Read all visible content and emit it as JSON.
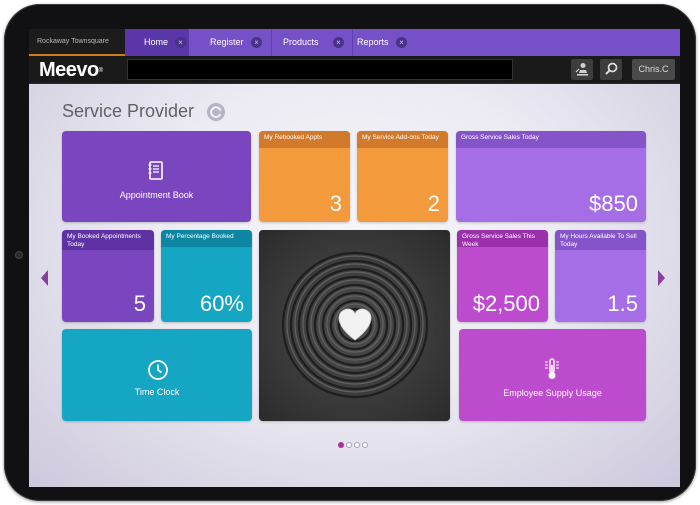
{
  "tabs": {
    "location": "Rockaway Townsquare",
    "items": [
      {
        "label": "Home"
      },
      {
        "label": "Register"
      },
      {
        "label": "Products"
      },
      {
        "label": "Reports"
      }
    ],
    "close_glyph": "×"
  },
  "header": {
    "logo": "Meevo",
    "logo_mark": "®",
    "user": "Chris.C",
    "icons": [
      "user-stamp-icon",
      "search-icon"
    ]
  },
  "page": {
    "title": "Service Provider",
    "refresh_icon": "refresh-icon"
  },
  "tiles": {
    "appointment_book": {
      "label": "Appointment Book",
      "color": "#7a46c0",
      "icon": "book-icon"
    },
    "rebooked_appts": {
      "label": "My Rebooked Appts",
      "value": "3",
      "color": "#f39a3c"
    },
    "service_addons": {
      "label": "My Service Add-ons Today",
      "value": "2",
      "color": "#f39a3c"
    },
    "gross_service_sales_today": {
      "label": "Gross Service Sales Today",
      "value": "$850",
      "color": "#a66ee6"
    },
    "booked_appts": {
      "label": "My Booked Appointments Today",
      "value": "5",
      "color": "#7a46c0"
    },
    "percentage_booked": {
      "label": "My Percentage Booked",
      "value": "60%",
      "color": "#15a6c4"
    },
    "zen_image": {
      "icon": "heart-stone-icon"
    },
    "gross_service_sales_week": {
      "label": "Gross Service Sales This Week",
      "value": "$2,500",
      "color": "#bc4bcd"
    },
    "hours_available": {
      "label": "My Hours Available To Sell Today",
      "value": "1.5",
      "color": "#a66ee6"
    },
    "time_clock": {
      "label": "Time Clock",
      "color": "#15a6c4",
      "icon": "clock-icon"
    },
    "supply_usage": {
      "label": "Employee Supply Usage",
      "color": "#bc4bcd",
      "icon": "thermometer-icon"
    }
  },
  "pagination": {
    "pages": 4,
    "current": 1
  }
}
